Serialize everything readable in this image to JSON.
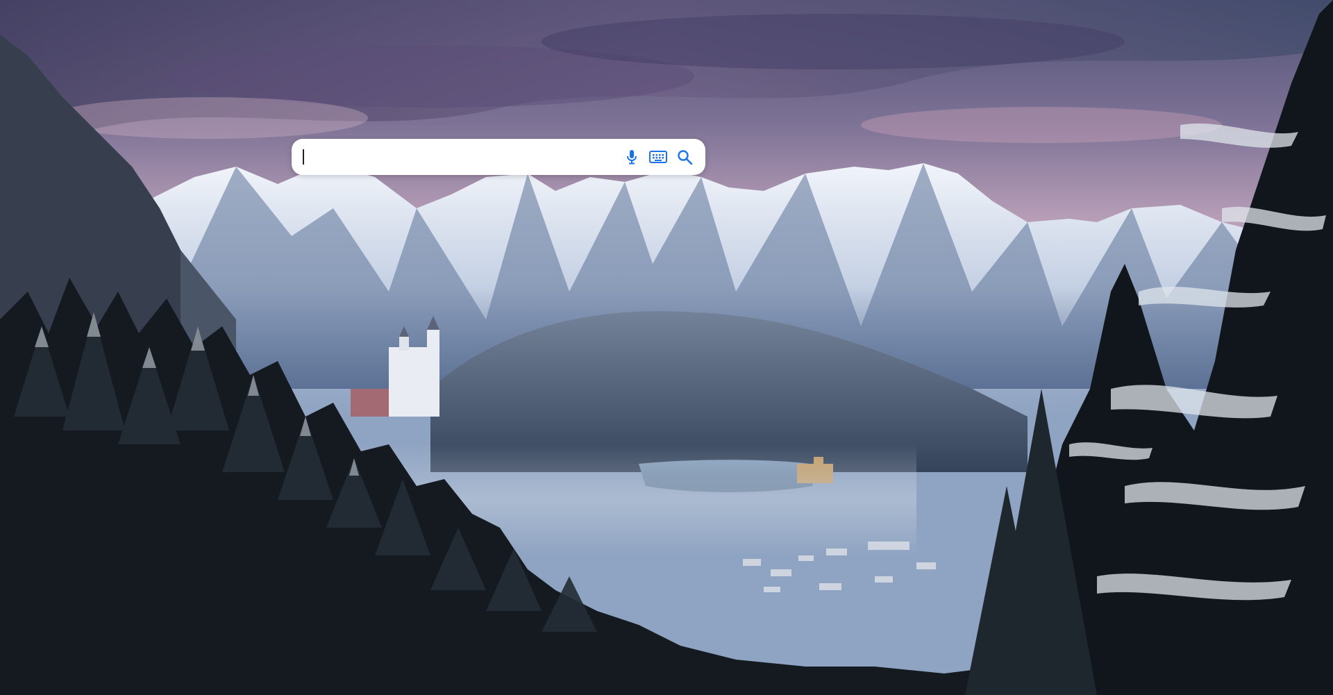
{
  "background": {
    "scene": "snowy-alpine-landscape",
    "sky_colors": [
      "#5a5f86",
      "#8a7ea0",
      "#c9a7bd",
      "#9fb3d0"
    ],
    "mountain_color": "#dfe6f1",
    "forest_color": "#1b2127"
  },
  "search": {
    "value": "",
    "placeholder": "",
    "icons": {
      "voice": "microphone-icon",
      "keyboard": "keyboard-icon",
      "submit": "search-icon"
    },
    "icon_color": "#1a73e8"
  }
}
